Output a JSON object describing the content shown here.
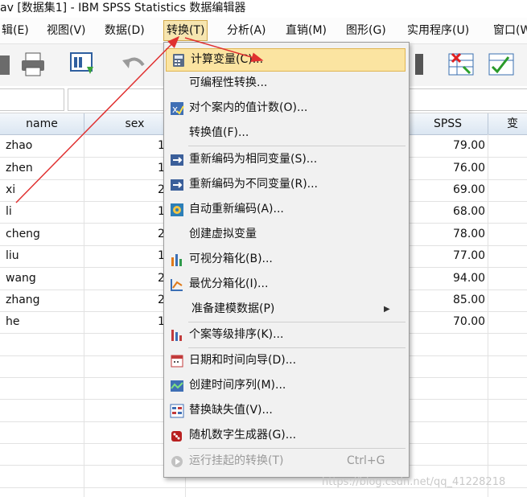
{
  "window": {
    "title": "av [数据集1] - IBM SPSS Statistics 数据编辑器"
  },
  "menubar": [
    {
      "label": "辑(E)"
    },
    {
      "label": "视图(V)"
    },
    {
      "label": "数据(D)"
    },
    {
      "label": "转换(T)"
    },
    {
      "label": "分析(A)"
    },
    {
      "label": "直销(M)"
    },
    {
      "label": "图形(G)"
    },
    {
      "label": "实用程序(U)"
    },
    {
      "label": "窗口(W"
    }
  ],
  "grid": {
    "headers": [
      "name",
      "sex",
      "SPSS",
      "变"
    ],
    "rows": [
      {
        "name": "zhao",
        "sex": "1",
        "spss": "79.00"
      },
      {
        "name": "zhen",
        "sex": "1",
        "spss": "76.00"
      },
      {
        "name": "xi",
        "sex": "2",
        "spss": "69.00"
      },
      {
        "name": "li",
        "sex": "1",
        "spss": "68.00"
      },
      {
        "name": "cheng",
        "sex": "2",
        "spss": "78.00"
      },
      {
        "name": "liu",
        "sex": "1",
        "spss": "77.00"
      },
      {
        "name": "wang",
        "sex": "2",
        "spss": "94.00"
      },
      {
        "name": "zhang",
        "sex": "2",
        "spss": "85.00"
      },
      {
        "name": "he",
        "sex": "1",
        "spss": "70.00"
      }
    ]
  },
  "transform_menu": {
    "items": [
      {
        "label": "计算变量(C)...",
        "icon": "calculator-icon",
        "highlighted": true
      },
      {
        "label": "可编程性转换...",
        "icon": ""
      },
      {
        "label": "对个案内的值计数(O)...",
        "icon": "count-values-icon"
      },
      {
        "label": "转换值(F)...",
        "icon": ""
      },
      {
        "label": "重新编码为相同变量(S)...",
        "icon": "recode-same-icon"
      },
      {
        "label": "重新编码为不同变量(R)...",
        "icon": "recode-different-icon"
      },
      {
        "label": "自动重新编码(A)...",
        "icon": "auto-recode-icon"
      },
      {
        "label": "创建虚拟变量",
        "icon": ""
      },
      {
        "label": "可视分箱化(B)...",
        "icon": "visual-binning-icon"
      },
      {
        "label": "最优分箱化(I)...",
        "icon": "optimal-binning-icon"
      },
      {
        "label": "准备建模数据(P)",
        "icon": "",
        "submenu": true
      },
      {
        "label": "个案等级排序(K)...",
        "icon": "rank-cases-icon"
      },
      {
        "label": "日期和时间向导(D)...",
        "icon": "date-time-icon"
      },
      {
        "label": "创建时间序列(M)...",
        "icon": "time-series-icon"
      },
      {
        "label": "替换缺失值(V)...",
        "icon": "replace-missing-icon"
      },
      {
        "label": "随机数字生成器(G)...",
        "icon": "random-dice-icon"
      },
      {
        "label": "运行挂起的转换(T)",
        "icon": "run-pending-icon",
        "disabled": true,
        "shortcut": "Ctrl+G"
      }
    ]
  },
  "watermark": "https://blog.csdn.net/qq_41228218",
  "colors": {
    "highlight": "#fbe4a1",
    "annotation_arrow": "#e03030"
  }
}
